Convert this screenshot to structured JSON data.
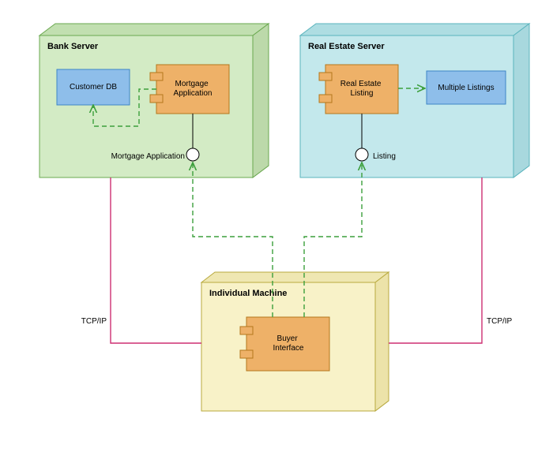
{
  "diagram_type": "UML Deployment Diagram",
  "nodes": {
    "bank_server": {
      "title": "Bank Server",
      "components": {
        "customer_db": "Customer DB",
        "mortgage_app": "Mortgage\nApplication"
      },
      "interface": "Mortgage Application"
    },
    "real_estate_server": {
      "title": "Real Estate Server",
      "components": {
        "real_estate_listing": "Real Estate\nListing",
        "multiple_listings": "Multiple Listings"
      },
      "interface": "Listing"
    },
    "individual_machine": {
      "title": "Individual Machine",
      "components": {
        "buyer_interface": "Buyer\nInterface"
      }
    }
  },
  "links": {
    "tcpip_left": "TCP/IP",
    "tcpip_right": "TCP/IP"
  },
  "colors": {
    "bank_server_fill": "#d3ebc5",
    "bank_server_stroke": "#6aa84f",
    "real_estate_fill": "#c3e8ec",
    "real_estate_stroke": "#5ab4bd",
    "individual_fill": "#f8f2c8",
    "individual_stroke": "#b8a93e",
    "component_orange_fill": "#eeb168",
    "component_orange_stroke": "#b4771c",
    "component_blue_fill": "#8ebeea",
    "component_blue_stroke": "#3d85c6",
    "dashed_green": "#3c9f3c",
    "solid_pink": "#ce2f72"
  }
}
